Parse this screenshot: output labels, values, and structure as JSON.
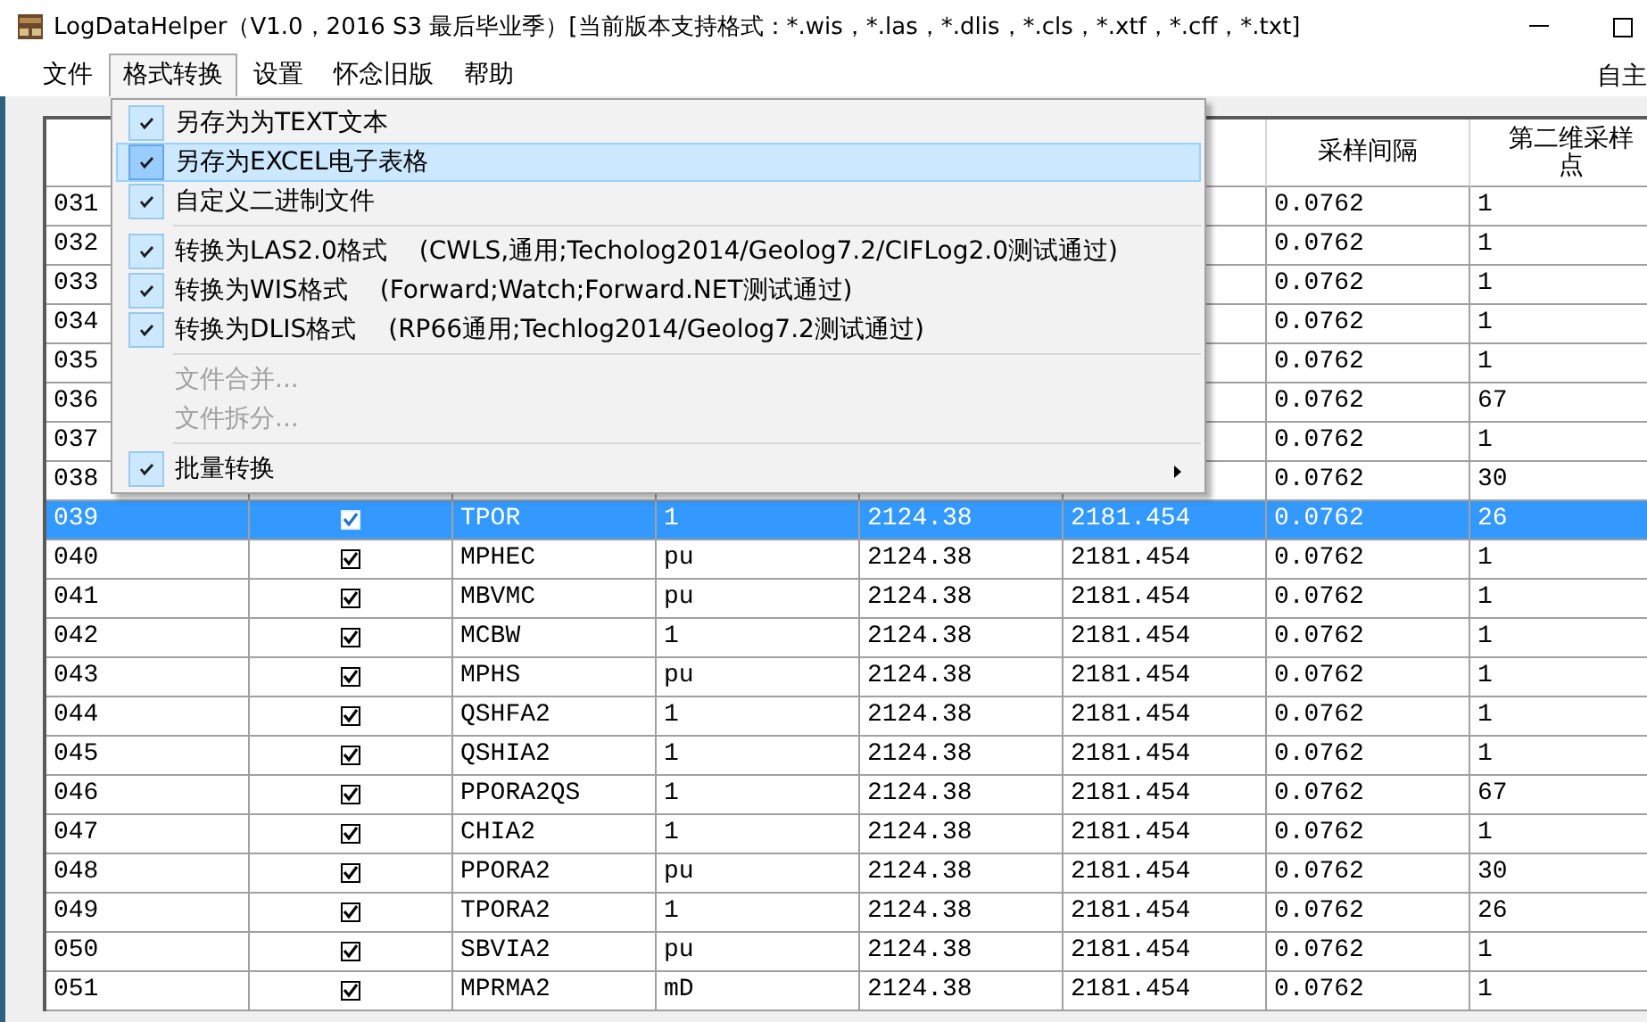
{
  "window": {
    "title": "LogDataHelper（V1.0，2016 S3 最后毕业季）[当前版本支持格式：*.wis，*.las，*.dlis，*.cls，*.xtf，*.cff，*.txt]"
  },
  "menu_bar": {
    "items": [
      {
        "label": "文件",
        "selected": false
      },
      {
        "label": "格式转换",
        "selected": true
      },
      {
        "label": "设置",
        "selected": false
      },
      {
        "label": "怀念旧版",
        "selected": false
      },
      {
        "label": "帮助",
        "selected": false
      }
    ],
    "right_label": "自主"
  },
  "table": {
    "headers": {
      "column_7": "采样间隔",
      "column_8": "第二维采样点"
    },
    "rows": [
      {
        "column_1": "031",
        "column_7": "0.0762",
        "column_8": "1",
        "selected": false
      },
      {
        "column_1": "032",
        "column_7": "0.0762",
        "column_8": "1",
        "selected": false
      },
      {
        "column_1": "033",
        "column_7": "0.0762",
        "column_8": "1",
        "selected": false
      },
      {
        "column_1": "034",
        "column_7": "0.0762",
        "column_8": "1",
        "selected": false
      },
      {
        "column_1": "035",
        "column_7": "0.0762",
        "column_8": "1",
        "selected": false
      },
      {
        "column_1": "036",
        "column_7": "0.0762",
        "column_8": "67",
        "selected": false
      },
      {
        "column_1": "037",
        "column_7": "0.0762",
        "column_8": "1",
        "selected": false
      },
      {
        "column_1": "038",
        "column_7": "0.0762",
        "column_8": "30",
        "selected": false
      },
      {
        "column_1": "039",
        "checked": true,
        "column_3": "TPOR",
        "column_4": "1",
        "column_5": "2124.38",
        "column_6": "2181.454",
        "column_7": "0.0762",
        "column_8": "26",
        "selected": true
      },
      {
        "column_1": "040",
        "checked": true,
        "column_3": "MPHEC",
        "column_4": "pu",
        "column_5": "2124.38",
        "column_6": "2181.454",
        "column_7": "0.0762",
        "column_8": "1",
        "selected": false
      },
      {
        "column_1": "041",
        "checked": true,
        "column_3": "MBVMC",
        "column_4": "pu",
        "column_5": "2124.38",
        "column_6": "2181.454",
        "column_7": "0.0762",
        "column_8": "1",
        "selected": false
      },
      {
        "column_1": "042",
        "checked": true,
        "column_3": "MCBW",
        "column_4": "1",
        "column_5": "2124.38",
        "column_6": "2181.454",
        "column_7": "0.0762",
        "column_8": "1",
        "selected": false
      },
      {
        "column_1": "043",
        "checked": true,
        "column_3": "MPHS",
        "column_4": "pu",
        "column_5": "2124.38",
        "column_6": "2181.454",
        "column_7": "0.0762",
        "column_8": "1",
        "selected": false
      },
      {
        "column_1": "044",
        "checked": true,
        "column_3": "QSHFA2",
        "column_4": "1",
        "column_5": "2124.38",
        "column_6": "2181.454",
        "column_7": "0.0762",
        "column_8": "1",
        "selected": false
      },
      {
        "column_1": "045",
        "checked": true,
        "column_3": "QSHIA2",
        "column_4": "1",
        "column_5": "2124.38",
        "column_6": "2181.454",
        "column_7": "0.0762",
        "column_8": "1",
        "selected": false
      },
      {
        "column_1": "046",
        "checked": true,
        "column_3": "PPORA2QS",
        "column_4": "1",
        "column_5": "2124.38",
        "column_6": "2181.454",
        "column_7": "0.0762",
        "column_8": "67",
        "selected": false
      },
      {
        "column_1": "047",
        "checked": true,
        "column_3": "CHIA2",
        "column_4": "1",
        "column_5": "2124.38",
        "column_6": "2181.454",
        "column_7": "0.0762",
        "column_8": "1",
        "selected": false
      },
      {
        "column_1": "048",
        "checked": true,
        "column_3": "PPORA2",
        "column_4": "pu",
        "column_5": "2124.38",
        "column_6": "2181.454",
        "column_7": "0.0762",
        "column_8": "30",
        "selected": false
      },
      {
        "column_1": "049",
        "checked": true,
        "column_3": "TPORA2",
        "column_4": "1",
        "column_5": "2124.38",
        "column_6": "2181.454",
        "column_7": "0.0762",
        "column_8": "26",
        "selected": false
      },
      {
        "column_1": "050",
        "checked": true,
        "column_3": "SBVIA2",
        "column_4": "pu",
        "column_5": "2124.38",
        "column_6": "2181.454",
        "column_7": "0.0762",
        "column_8": "1",
        "selected": false
      },
      {
        "column_1": "051",
        "checked": true,
        "column_3": "MPRMA2",
        "column_4": "mD",
        "column_5": "2124.38",
        "column_6": "2181.454",
        "column_7": "0.0762",
        "column_8": "1",
        "selected": false
      }
    ]
  },
  "dropdown_menu": {
    "items": [
      {
        "kind": "item",
        "label": "另存为为TEXT文本",
        "checked": true,
        "disabled": false,
        "selected": false
      },
      {
        "kind": "item",
        "label": "另存为EXCEL电子表格",
        "checked": true,
        "disabled": false,
        "selected": true
      },
      {
        "kind": "item",
        "label": "自定义二进制文件",
        "checked": true,
        "disabled": false,
        "selected": false
      },
      {
        "kind": "separator"
      },
      {
        "kind": "item",
        "label": "转换为LAS2.0格式",
        "note": "(CWLS,通用;Techolog2014/Geolog7.2/CIFLog2.0测试通过)",
        "checked": true,
        "disabled": false,
        "selected": false
      },
      {
        "kind": "item",
        "label": "转换为WIS格式",
        "note": "(Forward;Watch;Forward.NET测试通过)",
        "checked": true,
        "disabled": false,
        "selected": false
      },
      {
        "kind": "item",
        "label": "转换为DLIS格式",
        "note": "(RP66通用;Techlog2014/Geolog7.2测试通过)",
        "checked": true,
        "disabled": false,
        "selected": false
      },
      {
        "kind": "separator"
      },
      {
        "kind": "item",
        "label": "文件合并...",
        "checked": false,
        "disabled": true,
        "selected": false
      },
      {
        "kind": "item",
        "label": "文件拆分...",
        "checked": false,
        "disabled": true,
        "selected": false
      },
      {
        "kind": "separator"
      },
      {
        "kind": "item",
        "label": "批量转换",
        "checked": true,
        "disabled": false,
        "selected": false,
        "submenu": true
      }
    ]
  }
}
